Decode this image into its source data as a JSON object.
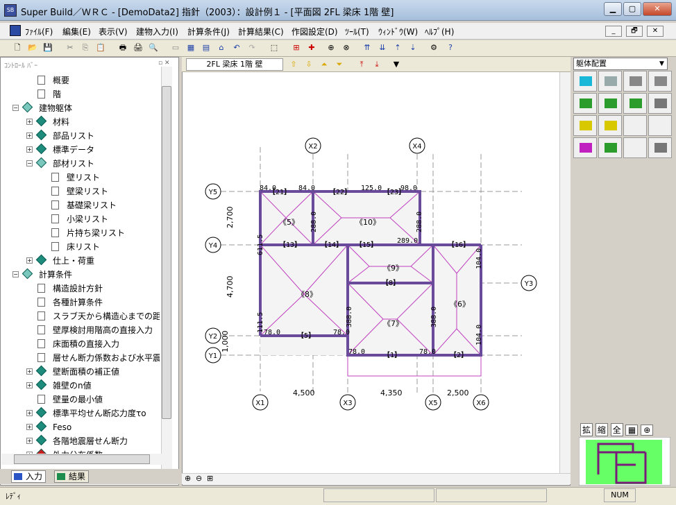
{
  "window": {
    "title": "Super Build／ＷＲＣ - [DemoData2] 指針（2003）：設計例１ - [平面図 2FL 梁床 1階 壁]",
    "icon": "app-logo-icon",
    "controls": [
      "minimize-icon",
      "maximize-icon",
      "close-icon"
    ]
  },
  "menu": {
    "items": [
      "ﾌｧｲﾙ(F)",
      "編集(E)",
      "表示(V)",
      "建物入力(I)",
      "計算条件(J)",
      "計算結果(C)",
      "作図設定(D)",
      "ﾂｰﾙ(T)",
      "ｳｨﾝﾄﾞｳ(W)",
      "ﾍﾙﾌﾟ(H)"
    ],
    "mdi_controls": [
      "_",
      "🗗",
      "✕"
    ]
  },
  "left_panel": {
    "title": "ｺﾝﾄﾛｰﾙ ﾊﾞｰ",
    "tree": [
      {
        "label": "概要",
        "icon": "doc",
        "level": 1
      },
      {
        "label": "階",
        "icon": "doc",
        "level": 1
      },
      {
        "label": "建物躯体",
        "icon": "folder-diamond",
        "level": 0,
        "expanded": true
      },
      {
        "label": "材料",
        "icon": "diamond",
        "level": 1
      },
      {
        "label": "部品リスト",
        "icon": "diamond",
        "level": 1
      },
      {
        "label": "標準データ",
        "icon": "diamond",
        "level": 1
      },
      {
        "label": "部材リスト",
        "icon": "folder-diamond",
        "level": 1,
        "expanded": true
      },
      {
        "label": "壁リスト",
        "icon": "doc",
        "level": 2
      },
      {
        "label": "壁梁リスト",
        "icon": "doc",
        "level": 2
      },
      {
        "label": "基礎梁リスト",
        "icon": "doc",
        "level": 2
      },
      {
        "label": "小梁リスト",
        "icon": "doc",
        "level": 2
      },
      {
        "label": "片持ち梁リスト",
        "icon": "doc",
        "level": 2
      },
      {
        "label": "床リスト",
        "icon": "doc",
        "level": 2
      },
      {
        "label": "仕上・荷重",
        "icon": "diamond",
        "level": 1
      },
      {
        "label": "計算条件",
        "icon": "folder-diamond",
        "level": 0,
        "expanded": true
      },
      {
        "label": "構造設計方針",
        "icon": "doc",
        "level": 1
      },
      {
        "label": "各種計算条件",
        "icon": "doc",
        "level": 1
      },
      {
        "label": "スラブ天から構造心までの距",
        "icon": "doc",
        "level": 1
      },
      {
        "label": "壁厚検討用階高の直接入力",
        "icon": "doc",
        "level": 1
      },
      {
        "label": "床面積の直接入力",
        "icon": "doc",
        "level": 1
      },
      {
        "label": "層せん断力係数および水平震",
        "icon": "doc",
        "level": 1
      },
      {
        "label": "壁断面積の補正値",
        "icon": "diamond",
        "level": 1
      },
      {
        "label": "雑壁のn値",
        "icon": "diamond",
        "level": 1
      },
      {
        "label": "壁量の最小値",
        "icon": "doc",
        "level": 1
      },
      {
        "label": "標準平均せん断応力度τo",
        "icon": "diamond",
        "level": 1
      },
      {
        "label": "Feso",
        "icon": "diamond",
        "level": 1
      },
      {
        "label": "各階地震層せん断力",
        "icon": "diamond",
        "level": 1
      },
      {
        "label": "外力分布係数",
        "icon": "stop-diamond",
        "level": 1
      }
    ],
    "tabs": [
      "入力",
      "結果"
    ]
  },
  "drawing": {
    "view_label": "2FL 梁床 1階 壁",
    "grid_x": [
      "X1",
      "X2",
      "X3",
      "X4",
      "X5",
      "X6"
    ],
    "grid_y": [
      "Y1",
      "Y2",
      "Y3",
      "Y4",
      "Y5"
    ],
    "spans_x": [
      "4,500",
      "4,350",
      "2,500"
    ],
    "spans_y": [
      "2,700",
      "4,700",
      "1,000"
    ],
    "rooms": [
      "《5》",
      "《10》",
      "《9》",
      "《8》",
      "《7》",
      "《6》"
    ],
    "beams": [
      "【21】",
      "【22】",
      "【23】",
      "【13】",
      "【14】",
      "【15】",
      "【16】",
      "【8】",
      "【5】",
      "【1】",
      "【2】"
    ],
    "dims": [
      "84.0",
      "84.0",
      "125.0",
      "98.0",
      "288.0",
      "288.0",
      "289.0",
      "611.5",
      "104.0",
      "388.0",
      "388.0",
      "111.5",
      "78.0",
      "78.0",
      "78.0",
      "78.0",
      "104.0",
      "78.0"
    ]
  },
  "right_panel": {
    "dropdown": "躯体配置",
    "buttons": [
      "拡",
      "縮",
      "全",
      "▦",
      "⊕"
    ]
  },
  "status": {
    "left": "ﾚﾃﾞｨ",
    "num": "NUM"
  }
}
